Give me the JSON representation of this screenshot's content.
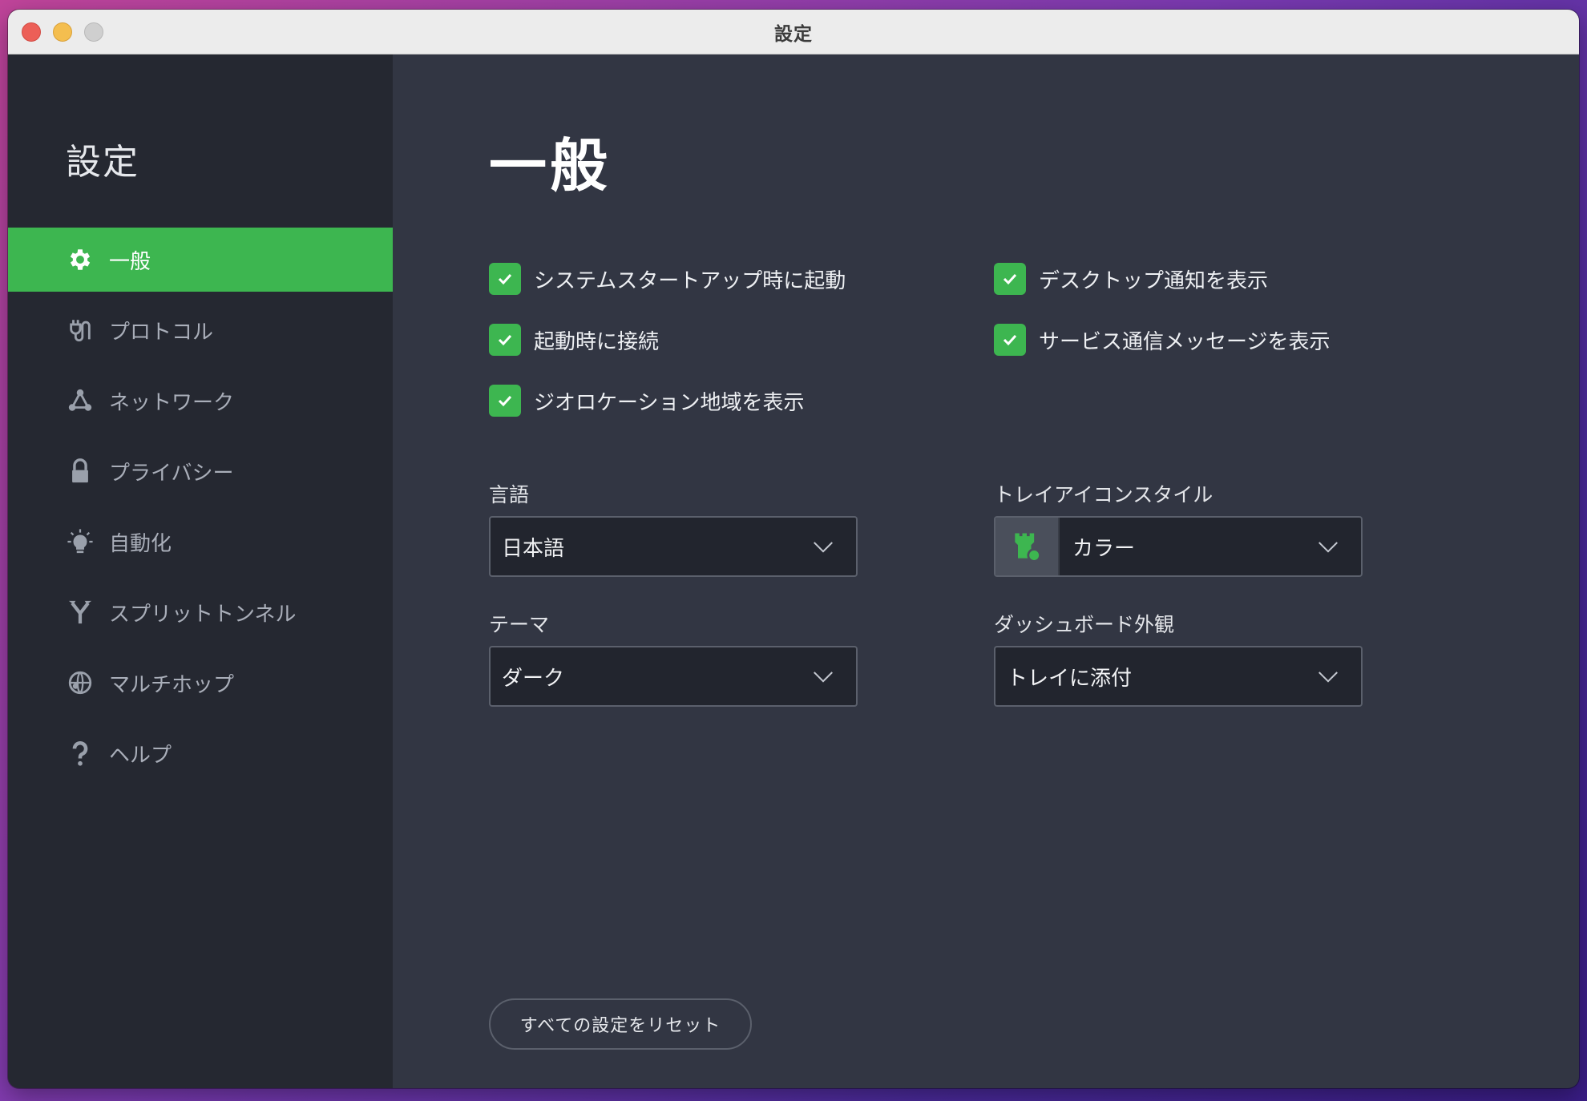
{
  "window": {
    "title": "設定"
  },
  "sidebar": {
    "title": "設定",
    "items": [
      {
        "label": "一般",
        "icon": "gear-icon",
        "active": true
      },
      {
        "label": "プロトコル",
        "icon": "plug-icon",
        "active": false
      },
      {
        "label": "ネットワーク",
        "icon": "network-icon",
        "active": false
      },
      {
        "label": "プライバシー",
        "icon": "lock-icon",
        "active": false
      },
      {
        "label": "自動化",
        "icon": "bulb-icon",
        "active": false
      },
      {
        "label": "スプリットトンネル",
        "icon": "split-icon",
        "active": false
      },
      {
        "label": "マルチホップ",
        "icon": "globe-icon",
        "active": false
      },
      {
        "label": "ヘルプ",
        "icon": "help-icon",
        "active": false
      }
    ]
  },
  "main": {
    "title": "一般",
    "checkboxes": [
      {
        "label": "システムスタートアップ時に起動",
        "checked": true
      },
      {
        "label": "起動時に接続",
        "checked": true
      },
      {
        "label": "ジオロケーション地域を表示",
        "checked": true
      },
      {
        "label": "デスクトップ通知を表示",
        "checked": true
      },
      {
        "label": "サービス通信メッセージを表示",
        "checked": true
      }
    ],
    "language": {
      "label": "言語",
      "value": "日本語"
    },
    "tray_icon_style": {
      "label": "トレイアイコンスタイル",
      "value": "カラー"
    },
    "theme": {
      "label": "テーマ",
      "value": "ダーク"
    },
    "dashboard_appearance": {
      "label": "ダッシュボード外観",
      "value": "トレイに添付"
    },
    "reset_label": "すべての設定をリセット"
  },
  "colors": {
    "accent": "#3db650",
    "sidebar_bg": "#252831",
    "content_bg": "#323643"
  }
}
